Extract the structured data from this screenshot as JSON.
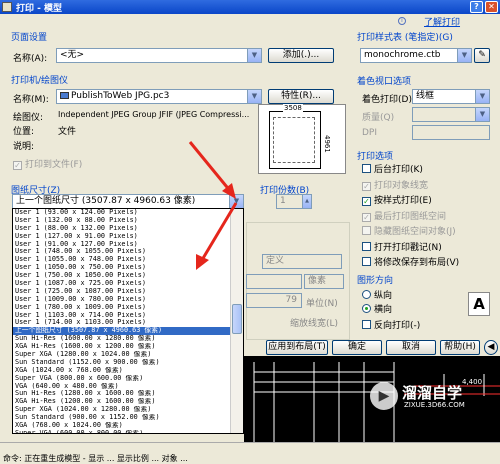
{
  "window": {
    "title": "打印 - 模型",
    "help_link": "了解打印"
  },
  "page_setup": {
    "group": "页面设置",
    "name_label": "名称(A):",
    "name_value": "<无>",
    "add_button": "添加(.)..."
  },
  "printer": {
    "group": "打印机/绘图仪",
    "name_label": "名称(M):",
    "name_value": "PublishToWeb JPG.pc3",
    "properties_button": "特性(R)...",
    "plotter_label": "绘图仪:",
    "plotter_value": "Independent JPEG Group JFIF (JPEG Compressi...",
    "location_label": "位置:",
    "location_value": "文件",
    "description_label": "说明:",
    "print_to_file": "打印到文件(F)",
    "preview_width": "3508",
    "preview_height": "4961"
  },
  "paper_size": {
    "group": "图纸尺寸(Z)",
    "selected": "上一个图纸尺寸  (3507.87 x 4960.63 像素)",
    "options": [
      "User 1 (93.00 x 124.00 Pixels)",
      "User 1 (132.00 x 88.00 Pixels)",
      "User 1 (88.00 x 132.00 Pixels)",
      "User 1 (127.00 x 91.00 Pixels)",
      "User 1 (91.00 x 127.00 Pixels)",
      "User 1 (748.00 x 1055.00 Pixels)",
      "User 1 (1055.00 x 748.00 Pixels)",
      "User 1 (1050.00 x 750.00 Pixels)",
      "User 1 (750.00 x 1050.00 Pixels)",
      "User 1 (1087.00 x 725.00 Pixels)",
      "User 1 (725.00 x 1087.00 Pixels)",
      "User 1 (1009.00 x 780.00 Pixels)",
      "User 1 (780.00 x 1009.00 Pixels)",
      "User 1 (1103.00 x 714.00 Pixels)",
      "User 1 (714.00 x 1103.00 Pixels)",
      "上一个图纸尺寸  (3507.87 x 4960.63 像素)",
      "Sun Hi-Res (1600.00 x 1280.00 像素)",
      "XGA Hi-Res (1600.00 x 1200.00 像素)",
      "Super XGA (1280.00 x 1024.00 像素)",
      "Sun Standard (1152.00 x 900.00 像素)",
      "XGA (1024.00 x 768.00 像素)",
      "Super VGA (800.00 x 600.00 像素)",
      "VGA (640.00 x 480.00 像素)",
      "Sun Hi-Res (1280.00 x 1600.00 像素)",
      "XGA Hi-Res (1200.00 x 1600.00 像素)",
      "Super XGA (1024.00 x 1280.00 像素)",
      "Sun Standard (900.00 x 1152.00 像素)",
      "XGA (768.00 x 1024.00 像素)",
      "Super VGA (600.00 x 800.00 像素)",
      "VGA (480.00 x 640.00 像素)"
    ],
    "selected_index": 15
  },
  "copies": {
    "label": "打印份数(B)",
    "value": "1"
  },
  "partial": {
    "define_label": "定义",
    "unit_value": "像素",
    "scale_value": "79",
    "unit_label": "单位(N)",
    "lineweight_label": "缩放线宽(L)"
  },
  "style_table": {
    "group": "打印样式表 (笔指定)(G)",
    "value": "monochrome.ctb"
  },
  "shaded_viewport": {
    "group": "着色视口选项",
    "shade_label": "着色打印(D)",
    "shade_value": "线框",
    "quality_label": "质量(Q)",
    "dpi_label": "DPI"
  },
  "plot_options": {
    "group": "打印选项",
    "items": [
      {
        "label": "后台打印(K)",
        "checked": false,
        "disabled": false
      },
      {
        "label": "打印对象线宽",
        "checked": true,
        "disabled": true
      },
      {
        "label": "按样式打印(E)",
        "checked": true,
        "disabled": false
      },
      {
        "label": "最后打印图纸空间",
        "checked": true,
        "disabled": true
      },
      {
        "label": "隐藏图纸空间对象(J)",
        "checked": false,
        "disabled": true
      },
      {
        "label": "打开打印戳记(N)",
        "checked": false,
        "disabled": false
      },
      {
        "label": "将修改保存到布局(V)",
        "checked": false,
        "disabled": false
      }
    ]
  },
  "orientation": {
    "group": "图形方向",
    "portrait": "纵向",
    "landscape": "横向",
    "reverse": "反向打印(-)"
  },
  "bottom_buttons": {
    "apply_layout": "应用到布局(T)",
    "ok": "确定",
    "cancel": "取消",
    "help": "帮助(H)"
  },
  "watermark": {
    "brand": "溜溜自学",
    "url": "ZIXUE.3D66.COM"
  },
  "cad": {
    "label": "4,400"
  },
  "status": {
    "text": "命令: 正在重生成模型 - 显示 ... 显示比例 ... 对象 ..."
  },
  "colors": {
    "arrow": "#e5261c",
    "selection": "#316ac5",
    "group_title": "#0044cc"
  }
}
